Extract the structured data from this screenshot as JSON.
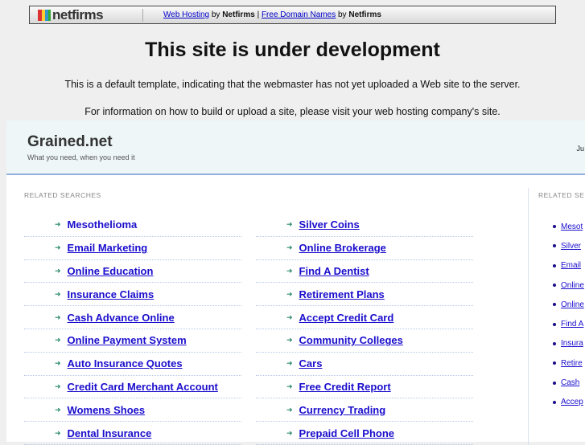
{
  "topbar": {
    "logo": "netfirms",
    "link1": "Web Hosting",
    "by1": "by",
    "brand1": "Netfirms",
    "pipe": "|",
    "link2": "Free Domain Names",
    "by2": "by",
    "brand2": "Netfirms"
  },
  "heading": "This site is under development",
  "info1": "This is a default template, indicating that the webmaster has not yet uploaded a Web site to the server.",
  "info2": "For information on how to build or upload a site, please visit your web hosting company's site.",
  "site": {
    "title": "Grained.net",
    "tagline": "What you need, when you need it",
    "right_text": "Ju"
  },
  "related_label": "RELATED SEARCHES",
  "col1": [
    "Mesothelioma",
    "Email Marketing",
    "Online Education",
    "Insurance Claims",
    "Cash Advance Online",
    "Online Payment System",
    "Auto Insurance Quotes",
    "Credit Card Merchant Account",
    "Womens Shoes",
    "Dental Insurance"
  ],
  "col2": [
    "Silver Coins",
    "Online Brokerage",
    "Find A Dentist",
    "Retirement Plans",
    "Accept Credit Card",
    "Community Colleges",
    "Cars",
    "Free Credit Report",
    "Currency Trading",
    "Prepaid Cell Phone"
  ],
  "side_label": "RELATED SE",
  "side": [
    "Mesot",
    "Silver",
    "Email",
    "Online",
    "Online",
    "Find A",
    "Insura",
    "Retire",
    "Cash",
    "Accep"
  ]
}
